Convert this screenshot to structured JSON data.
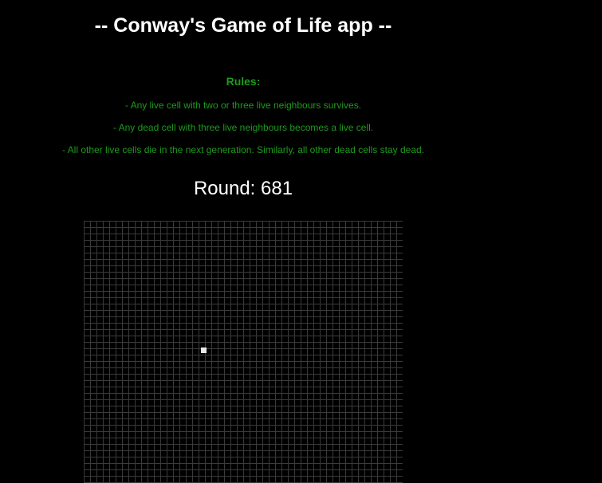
{
  "app": {
    "title": "-- Conway's Game of Life app --"
  },
  "rules": {
    "heading": "Rules:",
    "items": [
      "- Any live cell with two or three live neighbours survives.",
      "- Any dead cell with three live neighbours becomes a live cell.",
      "- All other live cells die in the next generation. Similarly, all other dead cells stay dead."
    ]
  },
  "round": {
    "text": "Round: 681"
  },
  "colors": {
    "background": "#000000",
    "title": "#ffffff",
    "rules_text": "#1e9a1e",
    "grid_line": "#3a3a3a",
    "live_cell": "#e8e8e8"
  }
}
